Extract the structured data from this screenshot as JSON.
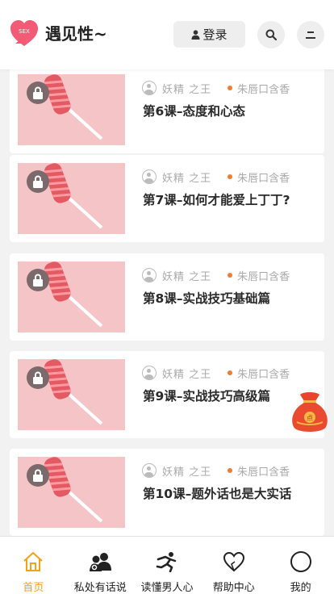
{
  "header": {
    "brand": "遇见性~",
    "logo_text": "SEX",
    "login_label": "登录",
    "icons": {
      "search": "search-icon",
      "menu": "menu-icon",
      "user": "user-icon"
    }
  },
  "colors": {
    "accent": "#f0a21a",
    "brand_pink": "#f25a76",
    "dot": "#f07c2e",
    "thumb_bg": "#f4c4c7"
  },
  "lessons": [
    {
      "author": "妖精 之王",
      "tag": "朱唇口含香",
      "title": "第6课–态度和心态",
      "locked": true
    },
    {
      "author": "妖精 之王",
      "tag": "朱唇口含香",
      "title": "第7课–如何才能爱上丁丁?",
      "locked": true
    },
    {
      "author": "妖精 之王",
      "tag": "朱唇口含香",
      "title": "第8课–实战技巧基础篇",
      "locked": true
    },
    {
      "author": "妖精 之王",
      "tag": "朱唇口含香",
      "title": "第9课–实战技巧高级篇",
      "locked": true
    },
    {
      "author": "妖精 之王",
      "tag": "朱唇口含香",
      "title": "第10课–题外话也是大实话",
      "locked": true
    }
  ],
  "floating_bag": {
    "label": "点"
  },
  "nav": [
    {
      "label": "首页",
      "icon": "home-icon",
      "active": true
    },
    {
      "label": "私处有话说",
      "icon": "users-icon",
      "active": false
    },
    {
      "label": "读懂男人心",
      "icon": "runner-icon",
      "active": false
    },
    {
      "label": "帮助中心",
      "icon": "heart-icon",
      "active": false
    },
    {
      "label": "我的",
      "icon": "profile-circle-icon",
      "active": false
    }
  ]
}
